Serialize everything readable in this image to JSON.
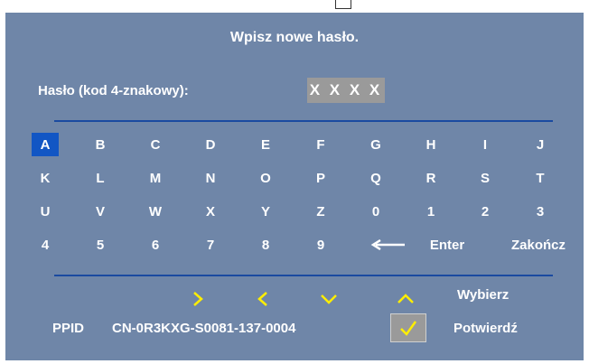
{
  "title": "Wpisz nowe hasło.",
  "password": {
    "label": "Hasło (kod 4-znakowy):",
    "value": "XXXX"
  },
  "keyboard": {
    "rows": [
      [
        "A",
        "B",
        "C",
        "D",
        "E",
        "F",
        "G",
        "H",
        "I",
        "J"
      ],
      [
        "K",
        "L",
        "M",
        "N",
        "O",
        "P",
        "Q",
        "R",
        "S",
        "T"
      ],
      [
        "U",
        "V",
        "W",
        "X",
        "Y",
        "Z",
        "0",
        "1",
        "2",
        "3"
      ],
      [
        "4",
        "5",
        "6",
        "7",
        "8",
        "9"
      ]
    ],
    "selected": "A",
    "backspace_icon": "left-arrow-icon",
    "enter_label": "Enter",
    "finish_label": "Zakończ"
  },
  "navigation": {
    "icons": [
      "right-chevron-icon",
      "left-chevron-icon",
      "down-chevron-icon",
      "up-chevron-icon"
    ],
    "select_label": "Wybierz"
  },
  "footer": {
    "ppid_label": "PPID",
    "ppid_value": "CN-0R3KXG-S0081-137-0004",
    "confirm_icon": "checkmark-icon",
    "confirm_label": "Potwierdź"
  },
  "colors": {
    "panel": "#6f86a8",
    "selection": "#1256c4",
    "rule": "#1a4aa0",
    "nav_icons": "#ffee00",
    "password_box": "#9a9a9a"
  }
}
